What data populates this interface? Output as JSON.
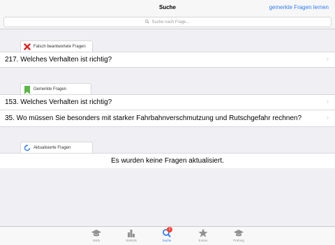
{
  "navbar": {
    "title": "Suche",
    "right_button": "gemerkte Fragen lernen"
  },
  "search": {
    "placeholder": "Suche nach Frage...",
    "icon": "search-icon"
  },
  "sections": {
    "wrong": {
      "header": "Falsch beantwortete Fragen",
      "icon": "red-x-icon",
      "rows": [
        "217. Welches Verhalten ist richtig?"
      ]
    },
    "bookmarked": {
      "header": "Gemerkte Fragen",
      "icon": "green-bookmark-icon",
      "rows": [
        "153. Welches Verhalten ist richtig?",
        "35. Wo müssen Sie besonders mit starker Fahrbahnverschmutzung und Rutschgefahr rechnen?"
      ]
    },
    "updated": {
      "header": "Aktualisierte Fragen",
      "icon": "refresh-icon",
      "message": "Es wurden keine Fragen aktualisiert."
    }
  },
  "tabbar": {
    "items": [
      {
        "label": "Mofa",
        "icon": "graduation-cap-icon"
      },
      {
        "label": "Statistik",
        "icon": "bar-chart-icon"
      },
      {
        "label": "Suche",
        "icon": "search-icon",
        "active": true,
        "badge": "2"
      },
      {
        "label": "Extras",
        "icon": "star-icon"
      },
      {
        "label": "Prüfung",
        "icon": "graduation-cap-icon"
      }
    ]
  },
  "colors": {
    "accent": "#2f7cf6",
    "background": "#efeff4",
    "error_red": "#e02020",
    "bookmark_green": "#5bb846",
    "badge_red": "#ff3b30"
  }
}
